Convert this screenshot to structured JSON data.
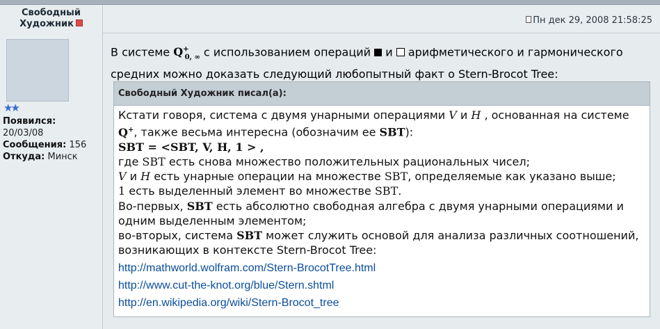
{
  "author": {
    "name_line1": "Свободный",
    "name_line2": "Художник",
    "rank_stars": "★★",
    "joined_label": "Появился:",
    "joined_value": "20/03/08",
    "posts_label": "Сообщения:",
    "posts_value": "156",
    "location_label": "Откуда:",
    "location_value": "Минск"
  },
  "post": {
    "date": "Пн дек 29, 2008 21:58:25",
    "intro_1": "В системе",
    "math_Q": "Q",
    "math_Q_sup": "+",
    "math_Q_sub": "0, ∞",
    "intro_2": "с использованием операций",
    "intro_3": "и",
    "intro_4": "арифметического и гармонического",
    "intro_line2": "средних можно доказать следующий любопытный факт о Stern-Brocot Tree:"
  },
  "quote": {
    "header": "Свободный Художник писал(а):",
    "l1a": "Кстати говоря, система с двумя унарными операциями",
    "l1V": "V",
    "l1b": "и",
    "l1H": "H",
    "l1c": ", основанная на системе",
    "l2Q": "Q",
    "l2Qsup": "+",
    "l2a": ", также весьма интересна (обозначим ее",
    "l2SBT": "SBT",
    "l2b": "):",
    "l3": "SBT = <SBT, V, H, 1 > ,",
    "l4a": "где",
    "l4SBT": "SBT",
    "l4b": "есть снова множество положительных рациональных чисел;",
    "l5V": "V",
    "l5a": "и",
    "l5H": "H",
    "l5b": "есть унарные операции на множестве",
    "l5SBT": "SBT",
    "l5c": ", определяемые как указано выше;",
    "l6one": "1",
    "l6a": "есть выделенный элемент во множестве",
    "l6SBT": "SBT",
    "l6b": ".",
    "l7a": "Во-первых,",
    "l7SBT": "SBT",
    "l7b": "есть абсолютно свободная алгебра с двумя унарными операциями и",
    "l8": "одним выделенным элементом;",
    "l9a": "во-вторых, система",
    "l9SBT": "SBT",
    "l9b": "может служить основой для анализа различных соотношений,",
    "l10": "возникающих в контексте Stern-Brocot Tree:",
    "links": [
      "http://mathworld.wolfram.com/Stern-BrocotTree.html",
      "http://www.cut-the-knot.org/blue/Stern.shtml",
      "http://en.wikipedia.org/wiki/Stern-Brocot_tree"
    ]
  },
  "colors": {
    "link": "#0a4d9b",
    "online_status": "#e04848",
    "stars": "#3a69d6"
  }
}
